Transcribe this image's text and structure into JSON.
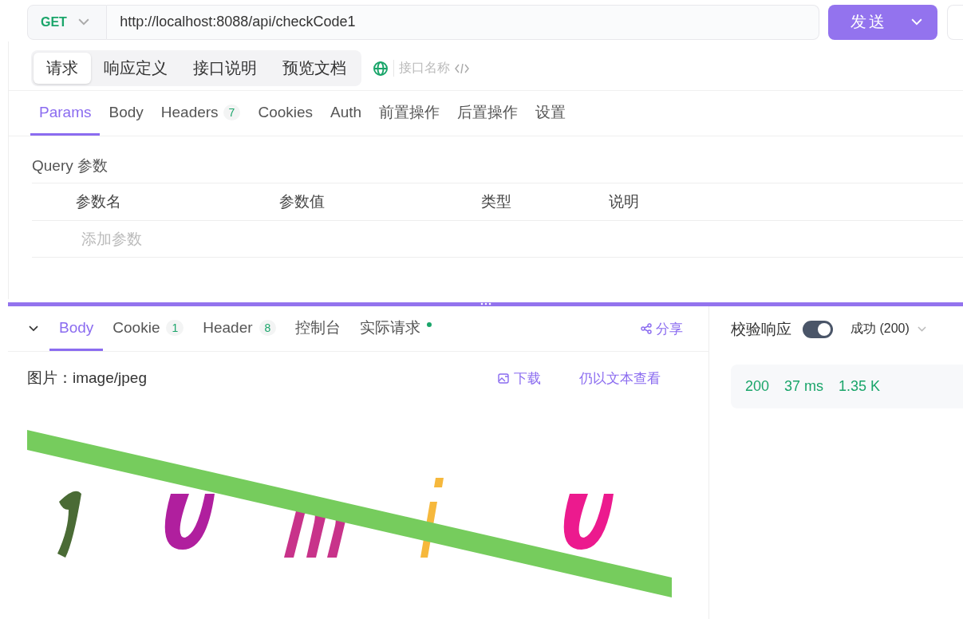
{
  "request": {
    "method": "GET",
    "url": "http://localhost:8088/api/checkCode1",
    "send_label": "发送"
  },
  "mode_tabs": [
    {
      "label": "请求",
      "selected": true
    },
    {
      "label": "响应定义",
      "selected": false
    },
    {
      "label": "接口说明",
      "selected": false
    },
    {
      "label": "预览文档",
      "selected": false
    }
  ],
  "name_placeholder": "接口名称",
  "param_tabs": [
    {
      "label": "Params",
      "selected": true
    },
    {
      "label": "Body",
      "selected": false
    },
    {
      "label": "Headers",
      "count": "7",
      "selected": false
    },
    {
      "label": "Cookies",
      "selected": false
    },
    {
      "label": "Auth",
      "selected": false
    },
    {
      "label": "前置操作",
      "selected": false
    },
    {
      "label": "后置操作",
      "selected": false
    },
    {
      "label": "设置",
      "selected": false
    }
  ],
  "query": {
    "title": "Query 参数",
    "columns": [
      "参数名",
      "参数值",
      "类型",
      "说明"
    ],
    "add_placeholder": "添加参数"
  },
  "response": {
    "tabs": [
      {
        "label": "Body",
        "selected": true,
        "dot": false
      },
      {
        "label": "Cookie",
        "count": "1",
        "selected": false,
        "dot": false
      },
      {
        "label": "Header",
        "count": "8",
        "selected": false,
        "dot": false
      },
      {
        "label": "控制台",
        "selected": false,
        "dot": false
      },
      {
        "label": "实际请求",
        "selected": false,
        "dot": true
      }
    ],
    "share": "分享",
    "content_type": "图片：image/jpeg",
    "download": "下载",
    "view_as_text": "仍以文本查看"
  },
  "validation": {
    "label": "校验响应",
    "on": true,
    "status": "成功 (200)",
    "stats": [
      "200",
      "37 ms",
      "1.35 K"
    ]
  }
}
